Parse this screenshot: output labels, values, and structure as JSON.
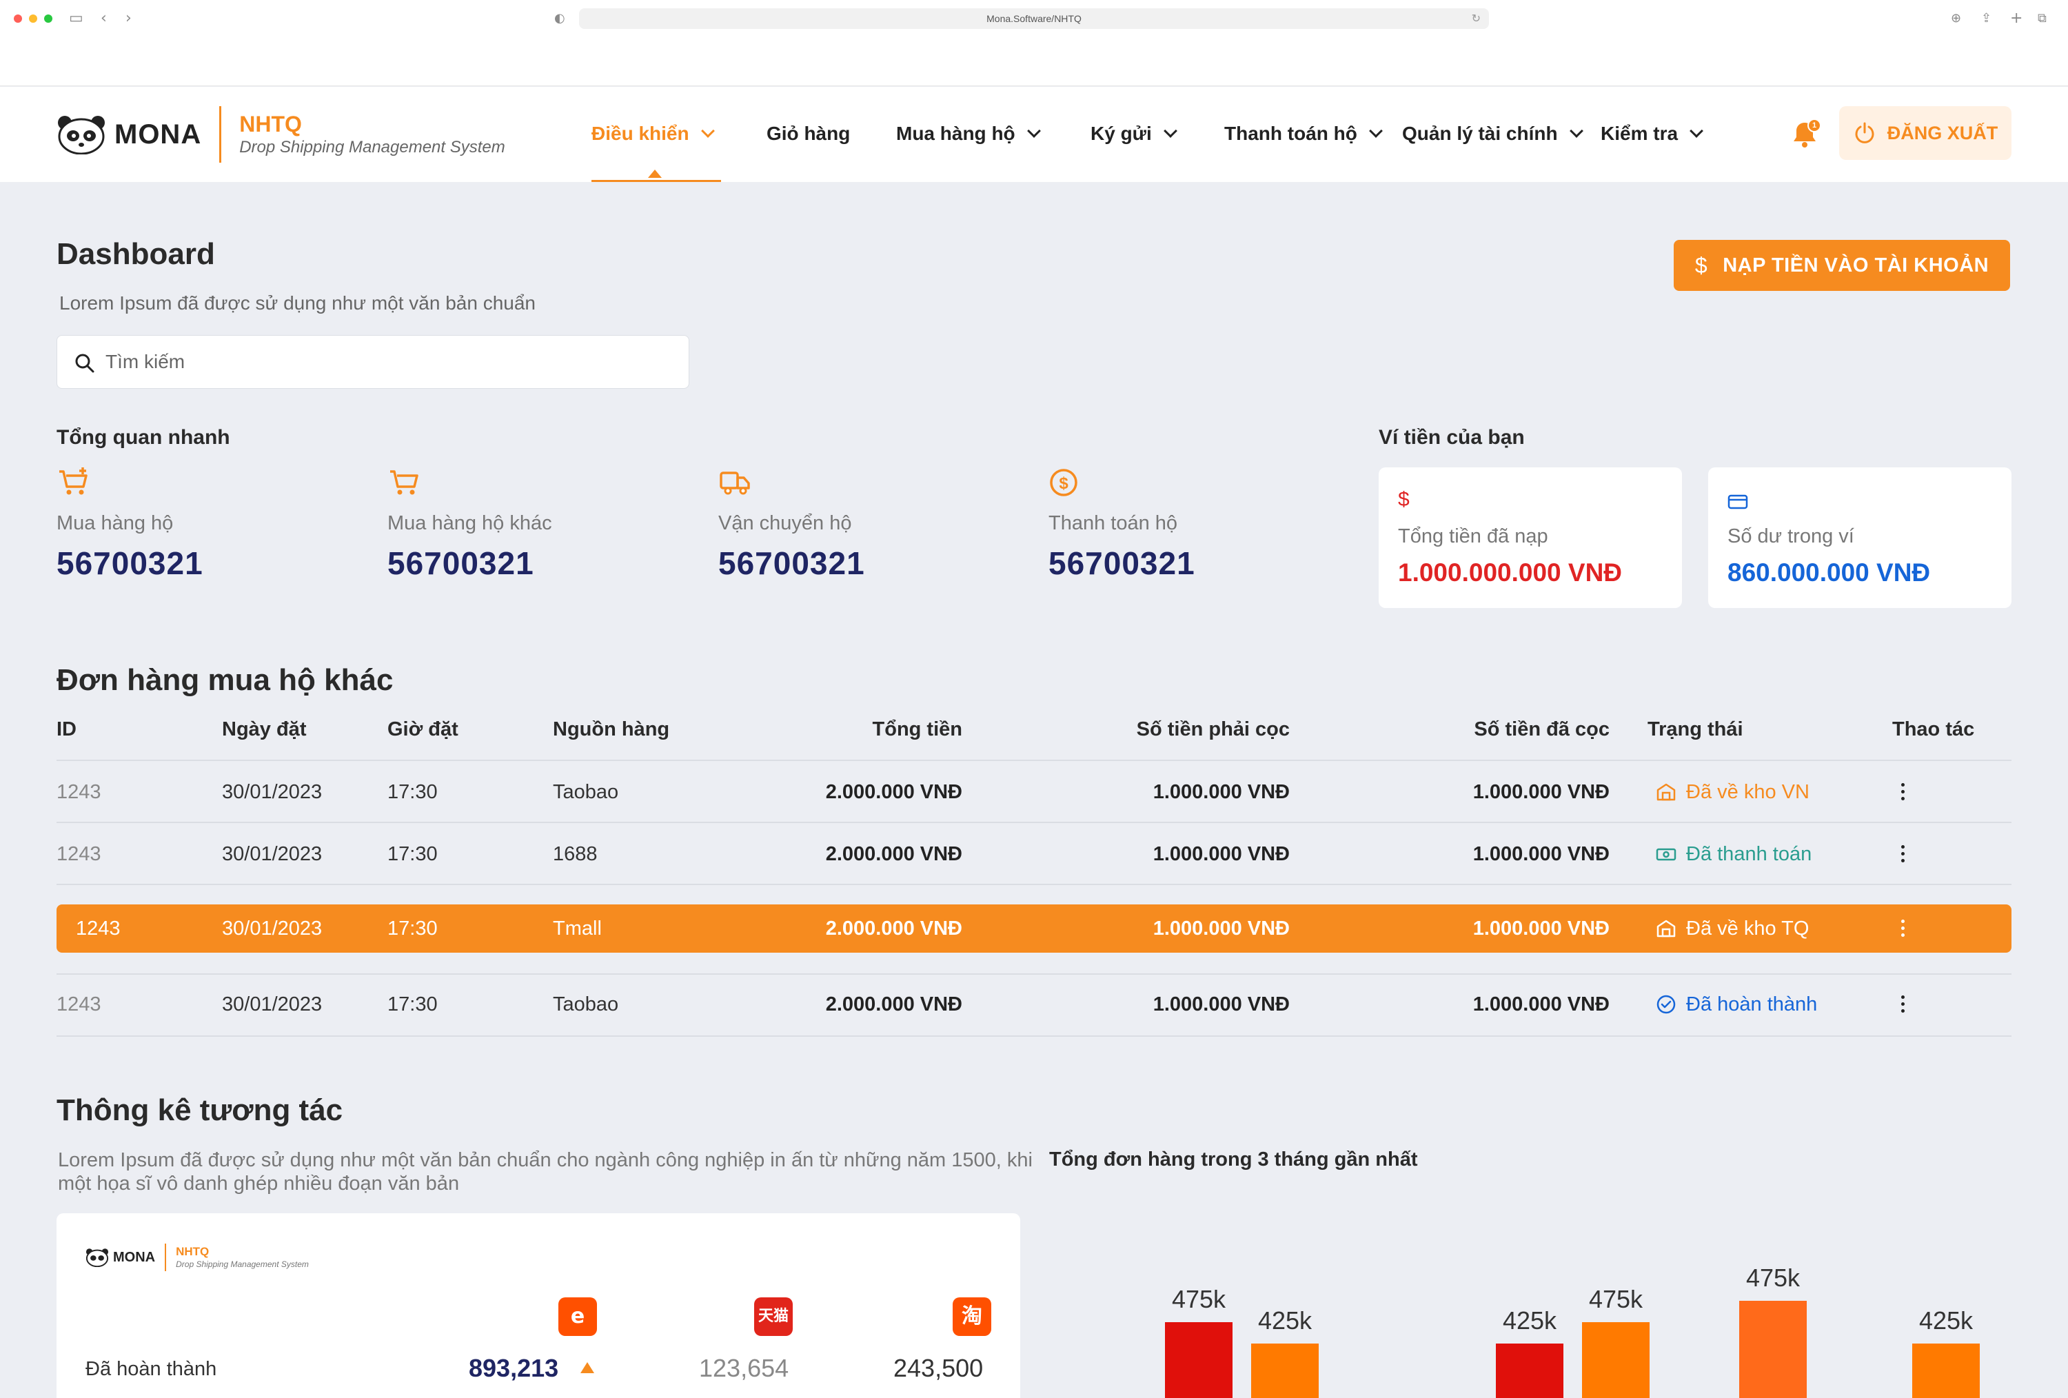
{
  "browser": {
    "url": "Mona.Software/NHTQ"
  },
  "brand": {
    "logo_text": "MONA",
    "title": "NHTQ",
    "subtitle": "Drop Shipping Management System"
  },
  "nav": {
    "items": [
      {
        "label": "Điều khiển",
        "has_dropdown": true,
        "active": true
      },
      {
        "label": "Giỏ hàng",
        "has_dropdown": false
      },
      {
        "label": "Mua hàng hộ",
        "has_dropdown": true
      },
      {
        "label": "Ký gửi",
        "has_dropdown": true
      },
      {
        "label": "Thanh toán hộ",
        "has_dropdown": true
      },
      {
        "label": "Quản lý tài chính",
        "has_dropdown": true
      },
      {
        "label": "Kiểm tra",
        "has_dropdown": true
      }
    ],
    "notification_count": "1",
    "logout_label": "ĐĂNG XUẤT"
  },
  "page": {
    "title": "Dashboard",
    "subtitle": "Lorem Ipsum đã được sử dụng như một văn bản chuẩn",
    "topup_label": "NẠP TIỀN VÀO TÀI KHOẢN",
    "search_placeholder": "Tìm kiếm"
  },
  "overview": {
    "title": "Tổng quan nhanh",
    "items": [
      {
        "icon": "cart-plus-icon",
        "label": "Mua hàng hộ",
        "value": "56700321"
      },
      {
        "icon": "cart-icon",
        "label": "Mua hàng hộ khác",
        "value": "56700321"
      },
      {
        "icon": "truck-icon",
        "label": "Vận chuyển hộ",
        "value": "56700321"
      },
      {
        "icon": "dollar-circle-icon",
        "label": "Thanh toán hộ",
        "value": "56700321"
      }
    ]
  },
  "wallet": {
    "title": "Ví tiền của bạn",
    "cards": [
      {
        "icon": "dollar-icon",
        "label": "Tổng tiền đã nạp",
        "value": "1.000.000.000 VNĐ",
        "color": "#E02424"
      },
      {
        "icon": "credit-card-icon",
        "label": "Số dư trong ví",
        "value": "860.000.000 VNĐ",
        "color": "#1565D8"
      }
    ]
  },
  "orders": {
    "title": "Đơn hàng mua hộ khác",
    "columns": [
      "ID",
      "Ngày đặt",
      "Giờ đặt",
      "Nguồn hàng",
      "Tổng tiền",
      "Số tiền phải cọc",
      "Số tiền đã cọc",
      "Trạng thái",
      "Thao tác"
    ],
    "rows": [
      {
        "id": "1243",
        "date": "30/01/2023",
        "time": "17:30",
        "source": "Taobao",
        "total": "2.000.000 VNĐ",
        "deposit_required": "1.000.000 VNĐ",
        "deposit_paid": "1.000.000 VNĐ",
        "status": "Đã về kho VN",
        "status_icon": "warehouse-icon",
        "status_color": "#F68B1F",
        "highlighted": false
      },
      {
        "id": "1243",
        "date": "30/01/2023",
        "time": "17:30",
        "source": "1688",
        "total": "2.000.000 VNĐ",
        "deposit_required": "1.000.000 VNĐ",
        "deposit_paid": "1.000.000 VNĐ",
        "status": "Đã thanh toán",
        "status_icon": "cash-icon",
        "status_color": "#2A9D8F",
        "highlighted": false
      },
      {
        "id": "1243",
        "date": "30/01/2023",
        "time": "17:30",
        "source": "Tmall",
        "total": "2.000.000 VNĐ",
        "deposit_required": "1.000.000 VNĐ",
        "deposit_paid": "1.000.000 VNĐ",
        "status": "Đã về kho TQ",
        "status_icon": "warehouse-icon",
        "status_color": "#FFFFFF",
        "highlighted": true
      },
      {
        "id": "1243",
        "date": "30/01/2023",
        "time": "17:30",
        "source": "Taobao",
        "total": "2.000.000 VNĐ",
        "deposit_required": "1.000.000 VNĐ",
        "deposit_paid": "1.000.000 VNĐ",
        "status": "Đã hoàn thành",
        "status_icon": "check-circle-icon",
        "status_color": "#1565D8",
        "highlighted": false
      }
    ]
  },
  "stats": {
    "title": "Thông kê tương tác",
    "description": "Lorem Ipsum đã được sử dụng như một văn bản chuẩn cho ngành công nghiệp in ấn từ những năm 1500, khi một họa sĩ vô danh ghép nhiều đoạn văn bản",
    "card": {
      "platforms": [
        {
          "name": "1688",
          "glyph": "e",
          "color": "#FF5000"
        },
        {
          "name": "Tmall",
          "glyph": "天猫",
          "color": "#E1251B"
        },
        {
          "name": "Taobao",
          "glyph": "淘",
          "color": "#FF5000"
        }
      ],
      "row_label": "Đã hoàn thành",
      "values": [
        "893,213",
        "123,654",
        "243,500"
      ],
      "trend": "up"
    }
  },
  "chart_data": {
    "type": "bar",
    "title": "Tổng đơn hàng trong 3 tháng gần nhất",
    "bars": [
      {
        "value": 475,
        "label": "475k",
        "color": "#E0100B"
      },
      {
        "value": 425,
        "label": "425k",
        "color": "#FF7A00"
      },
      {
        "value": 425,
        "label": "425k",
        "color": "#E0100B"
      },
      {
        "value": 475,
        "label": "475k",
        "color": "#FF7A00"
      },
      {
        "value": 525,
        "label": "475k",
        "color": "#FF6A1A"
      },
      {
        "value": 425,
        "label": "425k",
        "color": "#FF7A00"
      }
    ],
    "unit": "k"
  }
}
